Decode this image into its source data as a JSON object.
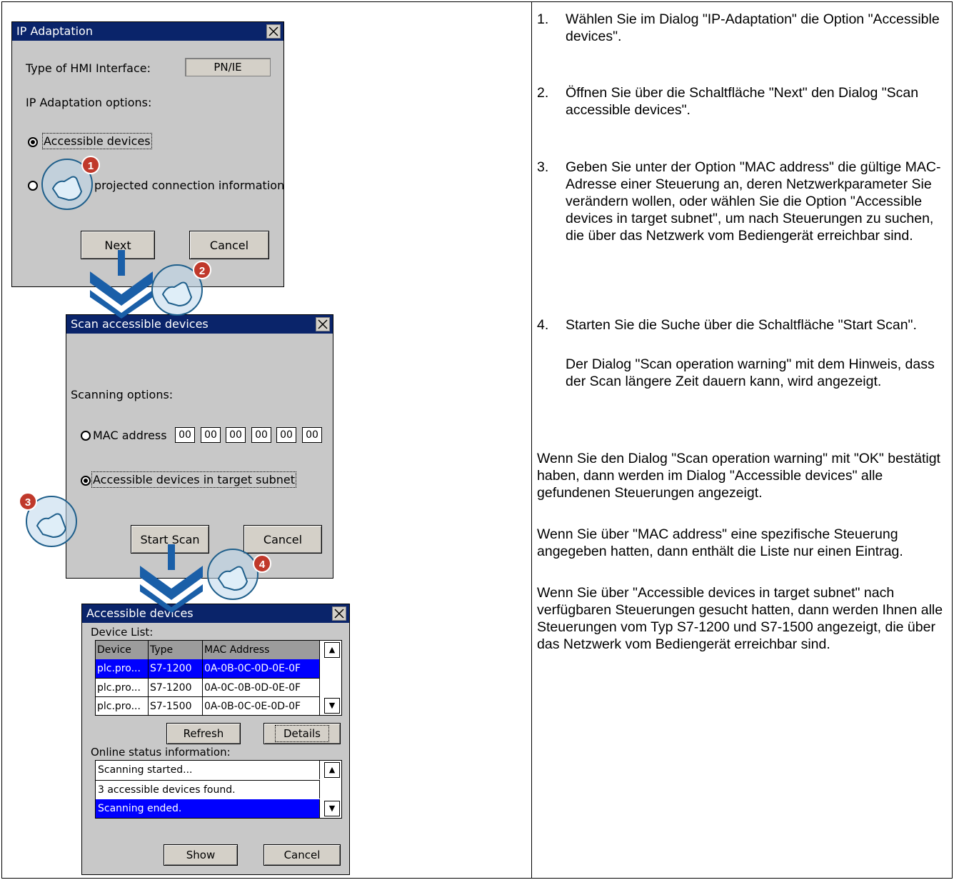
{
  "dialog_ip": {
    "title": "IP Adaptation",
    "type_label": "Type of HMI Interface:",
    "type_value": "PN/IE",
    "options_label": "IP Adaptation options:",
    "option1": "Accessible devices",
    "option2": "projected connection information",
    "next_label": "Next",
    "cancel_label": "Cancel"
  },
  "dialog_scan": {
    "title": "Scan accessible devices",
    "options_label": "Scanning options:",
    "mac_label": "MAC address",
    "mac_fields": [
      "00",
      "00",
      "00",
      "00",
      "00",
      "00"
    ],
    "subnet_label": "Accessible devices in target subnet",
    "start_label": "Start Scan",
    "cancel_label": "Cancel"
  },
  "dialog_devices": {
    "title": "Accessible devices",
    "list_label": "Device List:",
    "columns": [
      "Device",
      "Type",
      "MAC Address"
    ],
    "rows": [
      {
        "device": "plc.pro...",
        "type": "S7-1200",
        "mac": "0A-0B-0C-0D-0E-0F",
        "selected": true
      },
      {
        "device": "plc.pro...",
        "type": "S7-1200",
        "mac": "0A-0C-0B-0D-0E-0F",
        "selected": false
      },
      {
        "device": "plc.pro...",
        "type": "S7-1500",
        "mac": "0A-0B-0C-0E-0D-0F",
        "selected": false
      }
    ],
    "refresh_label": "Refresh",
    "details_label": "Details",
    "status_label": "Online status information:",
    "status_lines": [
      "Scanning started...",
      "3  accessible devices found.",
      "Scanning ended."
    ],
    "show_label": "Show",
    "cancel_label": "Cancel"
  },
  "badges": [
    "1",
    "2",
    "3",
    "4"
  ],
  "steps": [
    {
      "num": "1.",
      "text": "Wählen Sie im Dialog \"IP-Adaptation\" die Option \"Accessible devices\"."
    },
    {
      "num": "2.",
      "text": "Öffnen Sie über die Schaltfläche \"Next\" den Dialog \"Scan accessible devices\"."
    },
    {
      "num": "3.",
      "text": "Geben Sie unter der Option \"MAC address\" die gültige MAC-Adresse einer Steuerung an, deren Netzwerkparameter Sie verändern wollen, oder wählen Sie die Option \"Accessible devices in target subnet\", um nach Steuerungen zu suchen, die über das Netzwerk vom Bediengerät erreichbar sind."
    },
    {
      "num": "4.",
      "text": "Starten Sie die Suche über die Schaltfläche \"Start Scan\"."
    }
  ],
  "step4_note": "Der Dialog \"Scan operation warning\" mit dem Hinweis, dass der Scan längere Zeit dauern kann, wird angezeigt.",
  "paragraphs": [
    "Wenn Sie den Dialog \"Scan operation warning\" mit \"OK\" bestätigt haben, dann werden im Dialog \"Accessible devices\" alle gefundenen Steuerungen angezeigt.",
    "Wenn Sie über \"MAC address\" eine spezifische Steuerung angegeben hatten, dann enthält die Liste nur einen Eintrag.",
    "Wenn Sie über \"Accessible devices in target subnet\" nach verfügbaren Steuerungen gesucht hatten, dann werden Ihnen alle Steuerungen vom Typ S7-1200 und S7-1500 angezeigt, die über das Netzwerk vom Bediengerät erreichbar sind."
  ],
  "colors": {
    "titlebar": "#0a246a",
    "selection": "#0000ff",
    "dialog_bg": "#c8c8c8",
    "badge": "#c0392b",
    "arrow": "#1a5fa8"
  }
}
